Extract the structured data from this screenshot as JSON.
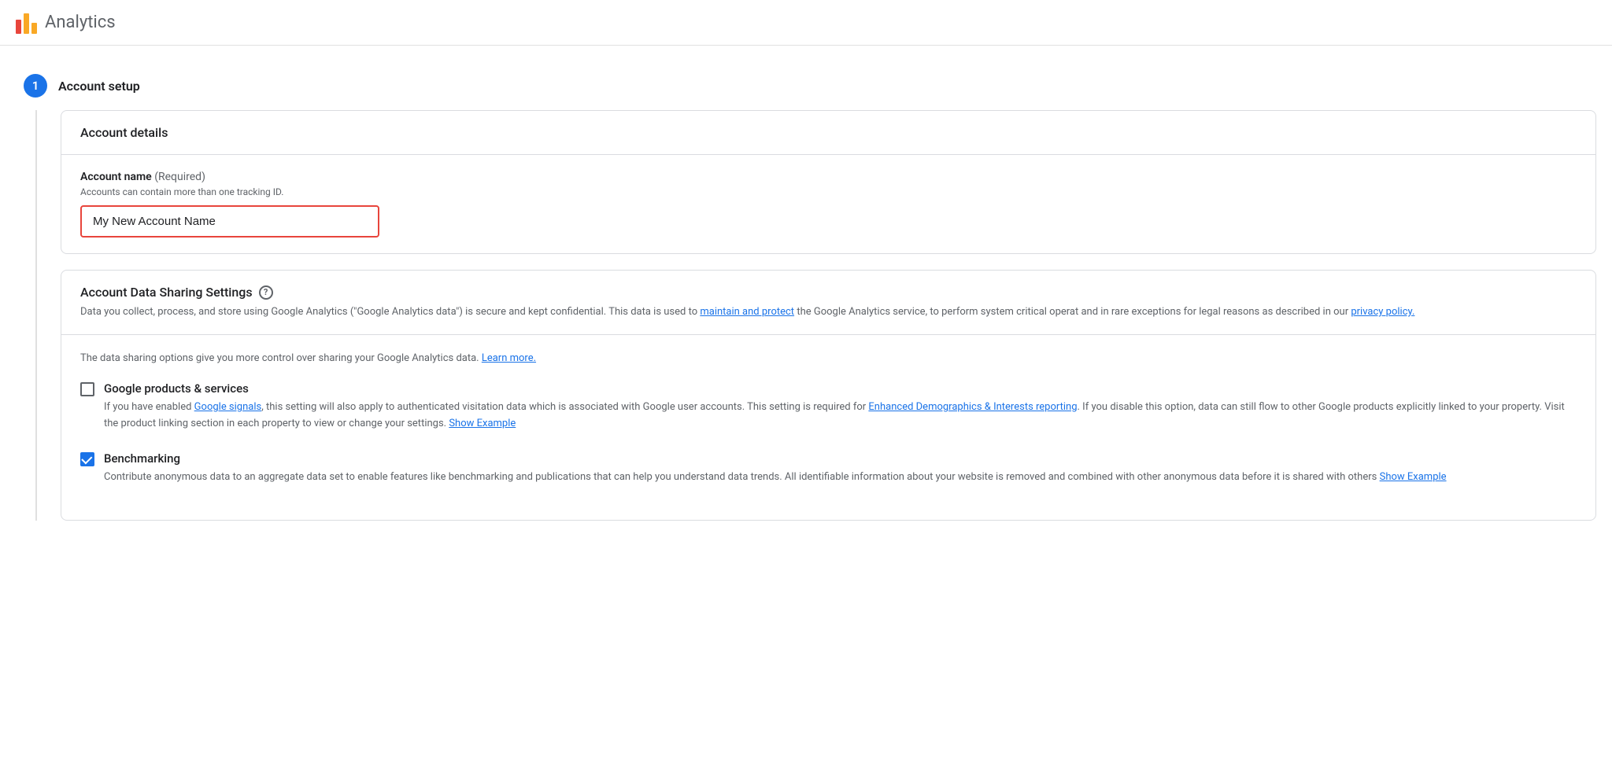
{
  "header": {
    "app_title": "Analytics",
    "logo_icon": "analytics-logo-icon"
  },
  "step": {
    "number": "1",
    "label": "Account setup"
  },
  "account_details_card": {
    "title": "Account details",
    "field": {
      "label": "Account name",
      "required_text": "(Required)",
      "hint": "Accounts can contain more than one tracking ID.",
      "value": "My New Account Name",
      "placeholder": "My New Account Name"
    }
  },
  "data_sharing_card": {
    "title": "Account Data Sharing Settings",
    "description": "Data you collect, process, and store using Google Analytics (\"Google Analytics data\") is secure and kept confidential. This data is used to",
    "maintain_link_text": "maintain and protect",
    "description_2": "the Google Analytics service, to perform system critical operat and in rare exceptions for legal reasons as described in our",
    "privacy_link_text": "privacy policy.",
    "intro_text": "The data sharing options give you more control over sharing your Google Analytics data.",
    "learn_more_text": "Learn more.",
    "checkboxes": [
      {
        "id": "google-products",
        "label": "Google products & services",
        "checked": false,
        "description_parts": [
          "If you have enabled ",
          "Google signals",
          ", this setting will also apply to authenticated visitation data which is associated with Google user accounts. This setting is required for ",
          "Enhanced Demographics & Interests reporting",
          ". If you disable this option, data can still flow to other Google products explicitly linked to your property. Visit the product linking section in each property to view or change your settings. ",
          "Show Example"
        ]
      },
      {
        "id": "benchmarking",
        "label": "Benchmarking",
        "checked": true,
        "description": "Contribute anonymous data to an aggregate data set to enable features like benchmarking and publications that can help you understand data trends. All identifiable information about your website is removed and combined with other anonymous data before it is shared with others",
        "show_example_text": "Show Example"
      }
    ]
  }
}
